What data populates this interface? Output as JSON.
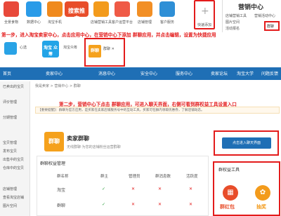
{
  "apps": [
    {
      "label": "全景食物",
      "color": "#e8493a"
    },
    {
      "label": "数据中心",
      "color": "#2a9be8"
    },
    {
      "label": "淘宝手机",
      "color": "#f08a1d"
    },
    {
      "label": "搜索推广",
      "color": "#e84d2a"
    },
    {
      "label": "店铺营销工具",
      "color": "#f39b1c"
    },
    {
      "label": "客户运营平台",
      "color": "#ef5a46"
    },
    {
      "label": "店铺管理",
      "color": "#f28f25"
    },
    {
      "label": "客户服务",
      "color": "#2e8fd6"
    },
    {
      "label": "快速添加",
      "color": "#ffffff"
    }
  ],
  "top_right": {
    "title": "营销中心",
    "links": [
      "店铺营销工具",
      "营销活动中心",
      "图片空间",
      "活动报名"
    ],
    "group": "群聊"
  },
  "step1": "第一步，进入淘宝卖家中心，点击应用中心，在营销中心下添加 群聊应用，并点击编辑，设置为快捷应用",
  "mid_apps": [
    {
      "icon": "无",
      "label": "心选"
    },
    {
      "icon": "淘宝\n众筹",
      "label": "淘宝众筹"
    },
    {
      "icon": "群聊",
      "label": "群聊 ✕"
    }
  ],
  "nav": {
    "items": [
      "首页",
      "卖家中心",
      "消息中心",
      "安全中心",
      "服务中心",
      "卖家论坛",
      "淘宝大学",
      "问题反馈"
    ],
    "left": "我是卖家"
  },
  "side": {
    "items": [
      "已卖出的宝贝",
      "评价管理",
      "分期管理",
      "宝贝管理",
      "发布宝贝",
      "出售中的宝贝",
      "仓库中的宝贝",
      "店铺管理",
      "查看淘宝店铺",
      "图片空间"
    ]
  },
  "breadcrumb": "我是卖家 > 营销中心 > 群聊",
  "step2": "第二步，营销中心下点击 群聊应用，可进入聊天界面，右侧可看到群权益工具设置入口",
  "notice": "【重要提醒】：群聊为官方应用，是买家在卖家店铺服务号中的互动工具，买家可在群内领取优惠券，了解店铺动态。",
  "app_card": {
    "icon": "群聊",
    "title": "卖家群聊",
    "desc": "无线群聊·为您的店铺粉丝运营群聊",
    "enter": "点击进入聊天界面"
  },
  "table": {
    "title": "群聊权益管理",
    "headers": [
      "群名称",
      "群主",
      "管理员",
      "群消息数",
      "活跃度"
    ],
    "rows": [
      {
        "name": "淘宝",
        "owner": "✓",
        "admin": "✕",
        "msgs": "✕",
        "act": "✕"
      },
      {
        "name": "群聊",
        "owner": "✓",
        "admin": "✕",
        "msgs": "✕",
        "act": "✕"
      }
    ]
  },
  "tools": {
    "title": "群权益工具",
    "items": [
      {
        "label": "群红包",
        "icon": "▦"
      },
      {
        "label": "抽奖",
        "icon": "✿"
      }
    ]
  }
}
